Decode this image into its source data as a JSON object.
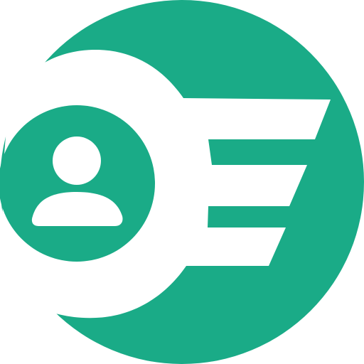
{
  "app_icon": {
    "icon_name": "user-speed-logo-icon",
    "colors": {
      "brand": "#1aab87",
      "foreground": "#ffffff",
      "background": "#ffffff"
    }
  }
}
